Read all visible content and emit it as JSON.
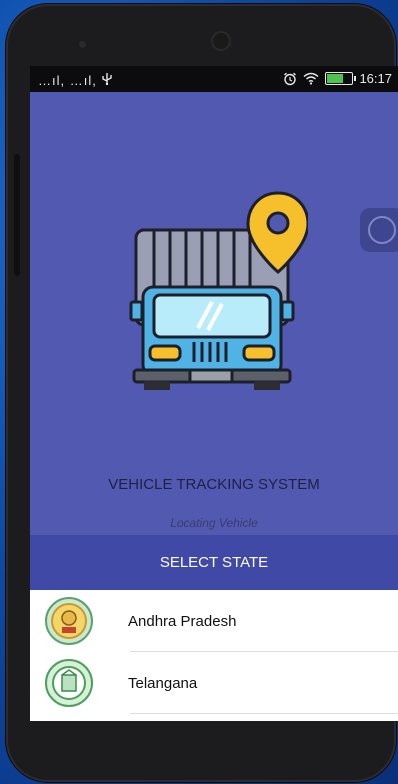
{
  "status_bar": {
    "signal_text": "…ıl, …ıl,",
    "usb_icon": "usb-icon",
    "alarm_icon": "alarm-icon",
    "wifi_icon": "wifi-icon",
    "battery_icon": "battery-icon",
    "time": "16:17"
  },
  "app": {
    "title": "VEHICLE TRACKING SYSTEM",
    "subtitle": "Locating Vehicle",
    "select_state_label": "SELECT STATE"
  },
  "states": [
    {
      "name": "Andhra Pradesh",
      "seal_icon": "andhra-pradesh-seal-icon"
    },
    {
      "name": "Telangana",
      "seal_icon": "telangana-seal-icon"
    }
  ],
  "colors": {
    "hero_bg": "#5159b0",
    "header_bg": "#4049a5",
    "truck_body": "#4fb3e6",
    "pin": "#f5c02b"
  }
}
